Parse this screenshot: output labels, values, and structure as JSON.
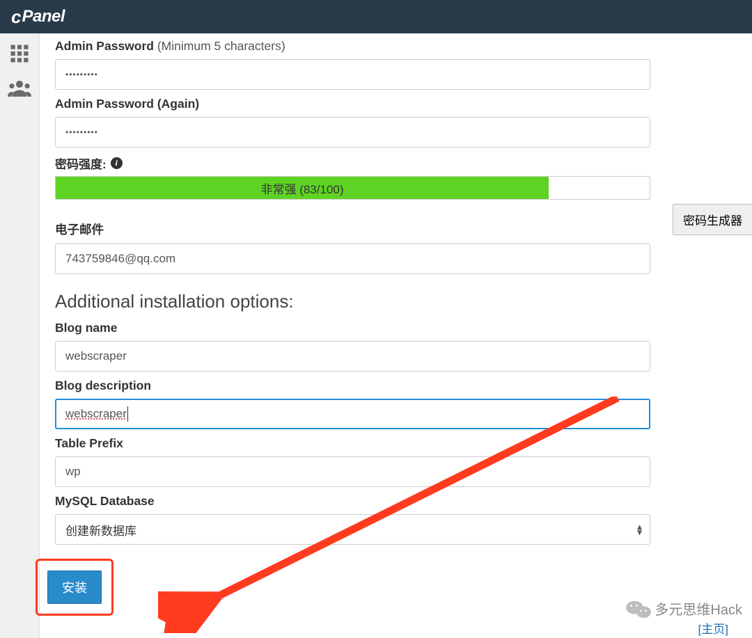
{
  "header": {
    "brand": "cPanel"
  },
  "form": {
    "admin_password_label": "Admin Password",
    "admin_password_hint": "(Minimum 5 characters)",
    "admin_password_value": "•••••••••",
    "admin_password_again_label": "Admin Password (Again)",
    "admin_password_again_value": "•••••••••",
    "strength_label": "密码强度:",
    "strength_text": "非常强 (83/100)",
    "strength_percent": 83,
    "generator_label": "密码生成器",
    "email_label": "电子邮件",
    "email_value": "743759846@qq.com",
    "section_title": "Additional installation options:",
    "blog_name_label": "Blog name",
    "blog_name_value": "webscraper",
    "blog_desc_label": "Blog description",
    "blog_desc_value": "webscraper",
    "table_prefix_label": "Table Prefix",
    "table_prefix_value": "wp",
    "mysql_label": "MySQL Database",
    "mysql_value": "创建新数据库",
    "install_label": "安装"
  },
  "footer": {
    "watermark": "多元思维Hack",
    "link": "主页"
  }
}
